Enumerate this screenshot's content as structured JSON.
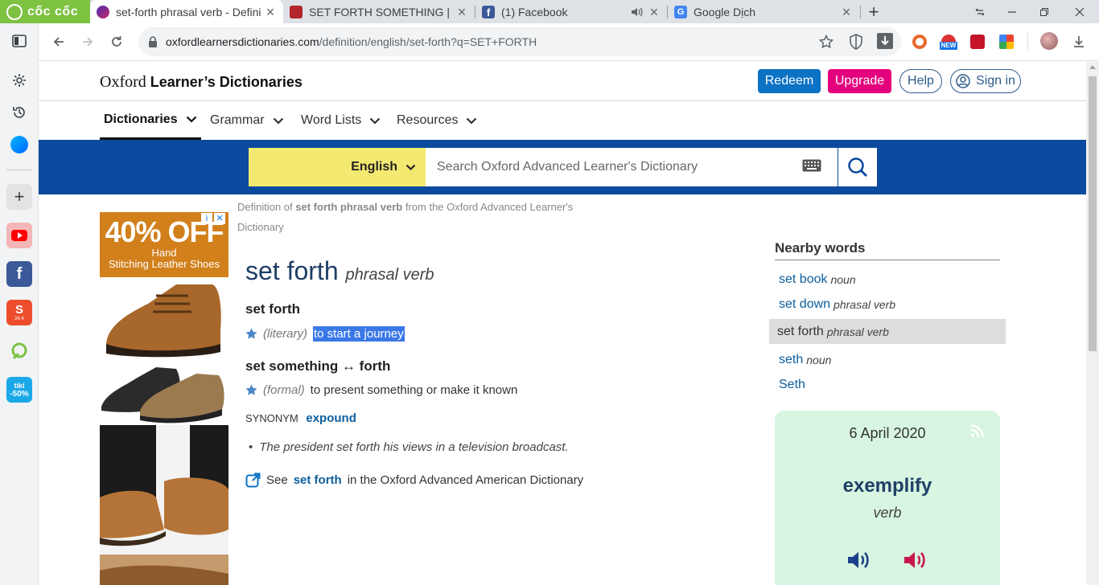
{
  "browser": {
    "brand": "cốc cốc",
    "tabs": [
      {
        "title": "set-forth phrasal verb - Definit",
        "active": true
      },
      {
        "title": "SET FORTH SOMETHING | Địn",
        "active": false
      },
      {
        "title": "(1) Facebook",
        "active": false
      },
      {
        "title": "Google Dịch",
        "active": false
      }
    ],
    "url_host": "oxfordlearnersdictionaries.com",
    "url_path": "/definition/english/set-forth?q=SET+FORTH",
    "extension_badge": "NEW"
  },
  "sidebar": {
    "shopee_badge": "24.4",
    "tiki_label": "tiki",
    "tiki_badge": "-50%"
  },
  "header": {
    "brand_oxford": "Oxford",
    "brand_rest": "Learner’s Dictionaries",
    "redeem": "Redeem",
    "upgrade": "Upgrade",
    "help": "Help",
    "sign_in": "Sign in"
  },
  "nav": {
    "items": [
      "Dictionaries",
      "Grammar",
      "Word Lists",
      "Resources"
    ]
  },
  "search": {
    "language": "English",
    "placeholder": "Search Oxford Advanced Learner's Dictionary"
  },
  "ad": {
    "headline": "40% OFF",
    "line1": "Hand",
    "line2": "Stitching Leather Shoes"
  },
  "entry": {
    "crumb_pre": "Definition of",
    "crumb_term": "set forth phrasal verb",
    "crumb_post": "from the Oxford Advanced Learner's Dictionary",
    "headword": "set forth",
    "pos": "phrasal verb",
    "senses": [
      {
        "head": "set forth",
        "label": "(literary)",
        "def": "to start a journey"
      },
      {
        "head": "set something ↔ forth",
        "label": "(formal)",
        "def": "to present something or make it known"
      }
    ],
    "synonym_label": "SYNONYM",
    "synonym": "expound",
    "example": "The president set forth his views in a television broadcast.",
    "see_pre": "See",
    "see_link": "set forth",
    "see_post": "in the Oxford Advanced American Dictionary"
  },
  "nearby": {
    "title": "Nearby words",
    "items": [
      {
        "word": "set book",
        "pos": "noun"
      },
      {
        "word": "set down",
        "pos": "phrasal verb"
      },
      {
        "word": "set forth",
        "pos": "phrasal verb"
      },
      {
        "word": "seth",
        "pos": "noun"
      },
      {
        "word": "Seth",
        "pos": ""
      }
    ]
  },
  "wotd": {
    "date": "6 April 2020",
    "word": "exemplify",
    "pos": "verb"
  },
  "colors": {
    "brand_blue": "#0b4a9e",
    "redeem": "#0b72c4",
    "upgrade": "#e4007c",
    "language_yellow": "#f3e971",
    "wotd_bg": "#d7f5e0"
  }
}
